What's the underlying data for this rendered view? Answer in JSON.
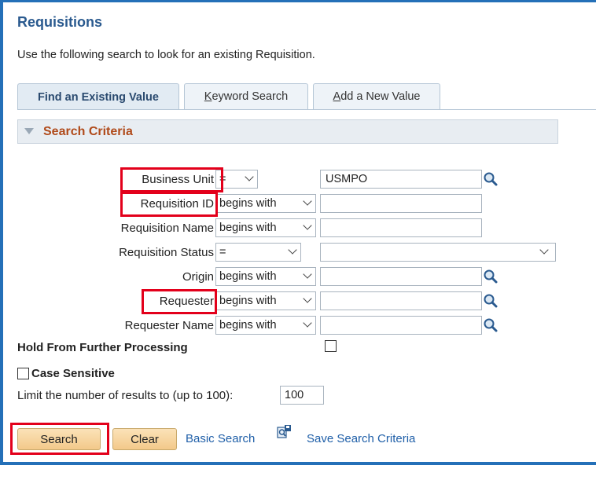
{
  "page": {
    "title": "Requisitions",
    "description": "Use the following search to look for an existing Requisition."
  },
  "tabs": [
    {
      "label": "Find an Existing Value",
      "active": true
    },
    {
      "label_prefix": "",
      "label_hotkey": "K",
      "label_rest": "eyword Search",
      "active": false
    },
    {
      "label_prefix": "",
      "label_hotkey": "A",
      "label_rest": "dd a New Value",
      "active": false
    }
  ],
  "section": {
    "title": "Search Criteria"
  },
  "criteria": [
    {
      "label": "Business Unit",
      "operator": "=",
      "value": "USMPO",
      "lookup": true
    },
    {
      "label": "Requisition ID",
      "operator": "begins with",
      "value": "",
      "lookup": false
    },
    {
      "label": "Requisition Name",
      "operator": "begins with",
      "value": "",
      "lookup": false
    },
    {
      "label": "Requisition Status",
      "operator": "=",
      "value": "",
      "lookup": false,
      "dropdown": true
    },
    {
      "label": "Origin",
      "operator": "begins with",
      "value": "",
      "lookup": true
    },
    {
      "label": "Requester",
      "operator": "begins with",
      "value": "",
      "lookup": true
    },
    {
      "label": "Requester Name",
      "operator": "begins with",
      "value": "",
      "lookup": true
    }
  ],
  "hold": {
    "label": "Hold From Further Processing",
    "checked": false
  },
  "case_sensitive": {
    "label": "Case Sensitive",
    "checked": false
  },
  "limit": {
    "label": "Limit the number of results to (up to 100):",
    "value": "100"
  },
  "actions": {
    "search_label": "Search",
    "clear_label": "Clear",
    "basic_search_label": "Basic Search",
    "save_criteria_label": "Save Search Criteria"
  },
  "colors": {
    "frame": "#2470b8",
    "title": "#2a5a8f",
    "section_title": "#b04a1a",
    "highlight": "#e3001b",
    "link": "#1f5fa8",
    "button": "#f3c98a"
  }
}
